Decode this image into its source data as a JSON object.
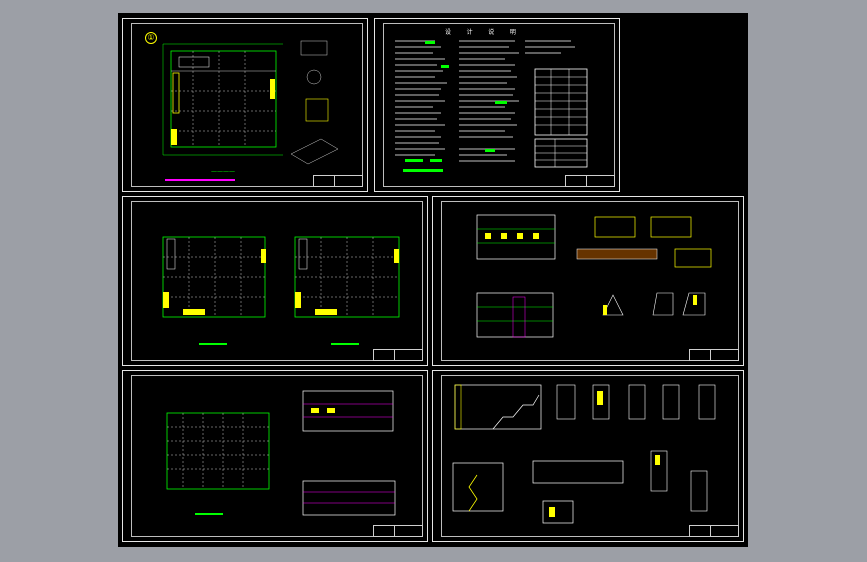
{
  "viewport": {
    "background": "#9c9fa6",
    "canvas_background": "#000000"
  },
  "colors": {
    "frame": "#e6e6e6",
    "grid": "#00ff00",
    "accent": "#ffff00",
    "highlight": "#ff00ff",
    "text": "#ffffff"
  },
  "sheets": [
    {
      "id": "floor-plan-1",
      "kind": "plan"
    },
    {
      "id": "design-notes",
      "kind": "notes",
      "title": "设 计 说 明"
    },
    {
      "id": "floor-plans-2-3",
      "kind": "plans"
    },
    {
      "id": "elevations-details",
      "kind": "elevations"
    },
    {
      "id": "roof-plan-elevations",
      "kind": "plan-elev"
    },
    {
      "id": "sections-details",
      "kind": "sections"
    }
  ],
  "sheet_number_mark": "①"
}
